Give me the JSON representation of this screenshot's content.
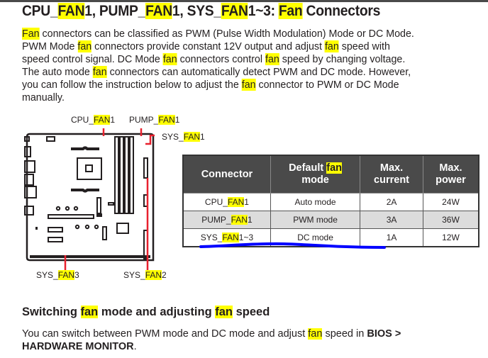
{
  "heading": {
    "parts": [
      "CPU_",
      "FAN",
      "1, PUMP_",
      "FAN",
      "1, SYS_",
      "FAN",
      "1~3: ",
      "Fan",
      " Connectors"
    ]
  },
  "intro": {
    "parts": [
      "Fan",
      " connectors can be classified as PWM (Pulse Width Modulation) Mode or DC Mode.\nPWM Mode ",
      "fan",
      " connectors provide constant 12V output and adjust ",
      "fan",
      " speed with\nspeed control signal. DC Mode ",
      "fan",
      " connectors control ",
      "fan",
      " speed by changing voltage.\nThe auto mode ",
      "fan",
      " connectors can automatically detect PWM and DC mode. However,\nyou can follow the instruction below to adjust the ",
      "fan",
      " connector to PWM or DC Mode\nmanually."
    ]
  },
  "diagram": {
    "labels": {
      "cpu_fan1": [
        "CPU_",
        "FAN",
        "1"
      ],
      "pump_fan1": [
        "PUMP_",
        "FAN",
        "1"
      ],
      "sys_fan1": [
        "SYS_",
        "FAN",
        "1"
      ],
      "sys_fan2": [
        "SYS_",
        "FAN",
        "2"
      ],
      "sys_fan3": [
        "SYS_",
        "FAN",
        "3"
      ]
    },
    "colors": {
      "pointer": "#e8212e",
      "outline": "#231f20"
    }
  },
  "table": {
    "headers": {
      "connector": "Connector",
      "mode_a": "Default ",
      "mode_hl": "fan",
      "mode_b": "mode",
      "current_a": "Max.",
      "current_b": "current",
      "power_a": "Max.",
      "power_b": "power"
    },
    "rows": [
      {
        "name_a": "CPU_",
        "name_hl": "FAN",
        "name_b": "1",
        "mode": "Auto mode",
        "current": "2A",
        "power": "24W"
      },
      {
        "name_a": "PUMP_",
        "name_hl": "FAN",
        "name_b": "1",
        "mode": "PWM mode",
        "current": "3A",
        "power": "36W"
      },
      {
        "name_a": "SYS_",
        "name_hl": "FAN",
        "name_b": "1~3",
        "mode": "DC mode",
        "current": "1A",
        "power": "12W"
      }
    ],
    "annotation_color": "#0000ff"
  },
  "section": {
    "title_parts": [
      "Switching ",
      "fan",
      " mode and adjusting ",
      "fan",
      " speed"
    ],
    "body_a": "You can switch between PWM mode and DC mode and adjust ",
    "body_hl": "fan",
    "body_b": " speed in ",
    "body_bold": "BIOS >\nHARDWARE MONITOR",
    "body_end": "."
  },
  "colors": {
    "highlight": "#ffff00",
    "header_bg": "#4a4a4a",
    "alt_row": "#dcdcdc"
  }
}
